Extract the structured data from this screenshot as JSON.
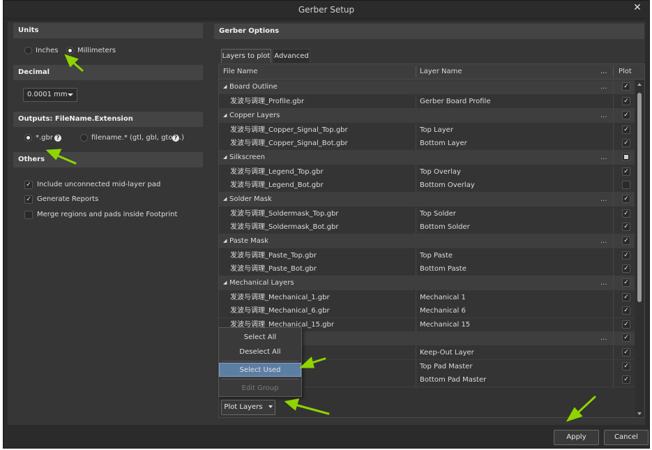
{
  "window": {
    "title": "Gerber Setup",
    "close_glyph": "✕"
  },
  "units": {
    "header": "Units",
    "options": [
      {
        "label": "Inches",
        "selected": false
      },
      {
        "label": "Millimeters",
        "selected": true
      }
    ]
  },
  "decimal": {
    "header": "Decimal",
    "value": "0.0001 mm"
  },
  "outputs": {
    "header": "Outputs: FileName.Extension",
    "options": [
      {
        "label": "*.gbr",
        "selected": true
      },
      {
        "label": "filename.* (gtl, gbl, gto,...)",
        "selected": false
      }
    ],
    "help_glyph": "?"
  },
  "others": {
    "header": "Others",
    "options": [
      {
        "label": "Include unconnected mid-layer pad",
        "checked": true
      },
      {
        "label": "Generate Reports",
        "checked": true
      },
      {
        "label": "Merge regions and pads inside Footprint",
        "checked": false
      }
    ]
  },
  "gerber_options": {
    "header": "Gerber Options",
    "tabs": [
      {
        "label": "Layers to plot",
        "active": true
      },
      {
        "label": "Advanced",
        "active": false
      }
    ],
    "columns": {
      "file_name": "File Name",
      "layer_name": "Layer Name",
      "ellipsis": "...",
      "plot": "Plot"
    },
    "rows": [
      {
        "type": "group",
        "label": "Board Outline",
        "plot": "checked"
      },
      {
        "type": "file",
        "file": "发波与调理_Profile.gbr",
        "layer": "Gerber Board Profile",
        "plot": "checked"
      },
      {
        "type": "group",
        "label": "Copper Layers",
        "plot": "checked"
      },
      {
        "type": "file",
        "file": "发波与调理_Copper_Signal_Top.gbr",
        "layer": "Top Layer",
        "plot": "checked"
      },
      {
        "type": "file",
        "file": "发波与调理_Copper_Signal_Bot.gbr",
        "layer": "Bottom Layer",
        "plot": "checked"
      },
      {
        "type": "group",
        "label": "Silkscreen",
        "plot": "partial"
      },
      {
        "type": "file",
        "file": "发波与调理_Legend_Top.gbr",
        "layer": "Top Overlay",
        "plot": "checked"
      },
      {
        "type": "file",
        "file": "发波与调理_Legend_Bot.gbr",
        "layer": "Bottom Overlay",
        "plot": "unchecked"
      },
      {
        "type": "group",
        "label": "Solder Mask",
        "plot": "checked"
      },
      {
        "type": "file",
        "file": "发波与调理_Soldermask_Top.gbr",
        "layer": "Top Solder",
        "plot": "checked"
      },
      {
        "type": "file",
        "file": "发波与调理_Soldermask_Bot.gbr",
        "layer": "Bottom Solder",
        "plot": "checked"
      },
      {
        "type": "group",
        "label": "Paste Mask",
        "plot": "checked"
      },
      {
        "type": "file",
        "file": "发波与调理_Paste_Top.gbr",
        "layer": "Top Paste",
        "plot": "checked"
      },
      {
        "type": "file",
        "file": "发波与调理_Paste_Bot.gbr",
        "layer": "Bottom Paste",
        "plot": "checked"
      },
      {
        "type": "group",
        "label": "Mechanical Layers",
        "plot": "checked"
      },
      {
        "type": "file",
        "file": "发波与调理_Mechanical_1.gbr",
        "layer": "Mechanical 1",
        "plot": "checked"
      },
      {
        "type": "file",
        "file": "发波与调理_Mechanical_6.gbr",
        "layer": "Mechanical 6",
        "plot": "checked"
      },
      {
        "type": "file",
        "file": "发波与调理_Mechanical_15.gbr",
        "layer": "Mechanical 15",
        "plot": "checked"
      },
      {
        "type": "group",
        "label": "",
        "plot": "checked"
      },
      {
        "type": "file",
        "file": "",
        "layer": "Keep-Out Layer",
        "plot": "checked"
      },
      {
        "type": "file",
        "file": "",
        "layer": "Top Pad Master",
        "plot": "checked"
      },
      {
        "type": "file",
        "file": "",
        "layer": "Bottom Pad Master",
        "plot": "checked"
      }
    ]
  },
  "context_menu": {
    "items": [
      {
        "label": "Select All",
        "state": "normal"
      },
      {
        "label": "Deselect All",
        "state": "normal"
      },
      {
        "label": "Select Used",
        "state": "selected"
      },
      {
        "label": "Edit Group",
        "state": "disabled"
      }
    ]
  },
  "plot_layers_button": {
    "label": "Plot Layers"
  },
  "footer": {
    "apply_label": "Apply",
    "cancel_label": "Cancel"
  },
  "colors": {
    "annotation_arrow": "#8fd400",
    "menu_highlight": "#5d7ea3"
  }
}
